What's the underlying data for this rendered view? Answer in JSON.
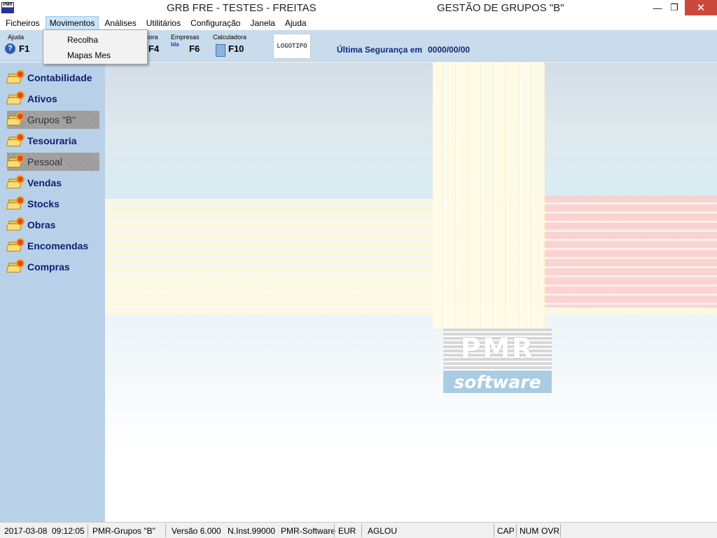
{
  "window": {
    "title_left": "GRB FRE - TESTES - FREITAS",
    "title_right": "GESTÃO DE GRUPOS \"B\"",
    "app_icon_text": "PMR",
    "minimize_label": "—",
    "restore_label": "❐",
    "close_label": "✕"
  },
  "menu": {
    "items": [
      "Ficheiros",
      "Movimentos",
      "Análises",
      "Utilitários",
      "Configuração",
      "Janela",
      "Ajuda"
    ],
    "active": "Movimentos",
    "dropdown": [
      "Recolha",
      "Mapas Mes"
    ]
  },
  "toolbar": {
    "help_label": "Ajuda",
    "help_key": "F1",
    "hidden_label": "sora",
    "hidden_key": "F4",
    "companies_label": "Empresas",
    "companies_key": "F6",
    "companies_icon_text": "Ida",
    "calculator_label": "Calculadora",
    "calculator_key": "F10",
    "logo_text": "LOGOTIPO",
    "last_backup_label": "Última Segurança em",
    "last_backup_date": "0000/00/00"
  },
  "sidebar": {
    "items": [
      {
        "label": "Contabilidade",
        "enabled": true
      },
      {
        "label": "Ativos",
        "enabled": true
      },
      {
        "label": "Grupos \"B\"",
        "enabled": false
      },
      {
        "label": "Tesouraria",
        "enabled": true
      },
      {
        "label": "Pessoal",
        "enabled": false
      },
      {
        "label": "Vendas",
        "enabled": true
      },
      {
        "label": "Stocks",
        "enabled": true
      },
      {
        "label": "Obras",
        "enabled": true
      },
      {
        "label": "Encomendas",
        "enabled": true
      },
      {
        "label": "Compras",
        "enabled": true
      }
    ]
  },
  "brand": {
    "pmr": "PMR",
    "software": "software"
  },
  "status": {
    "date": "2017-03-08",
    "time": "09:12:05",
    "module": "PMR-Grupos \"B\"",
    "version": "Versão  6.000",
    "install": "N.Inst.99000",
    "vendor": "PMR-Software",
    "currency": "EUR",
    "user": "AGLOU",
    "cap": "CAP",
    "num": "NUM",
    "ovr": "OVR"
  },
  "colors": {
    "sidebar_bg": "#b9d1e8",
    "toolbar_bg": "#c8dced",
    "sidebar_text": "#0b1f72",
    "close_button": "#c94a3d",
    "menu_active": "#cce4f7"
  }
}
